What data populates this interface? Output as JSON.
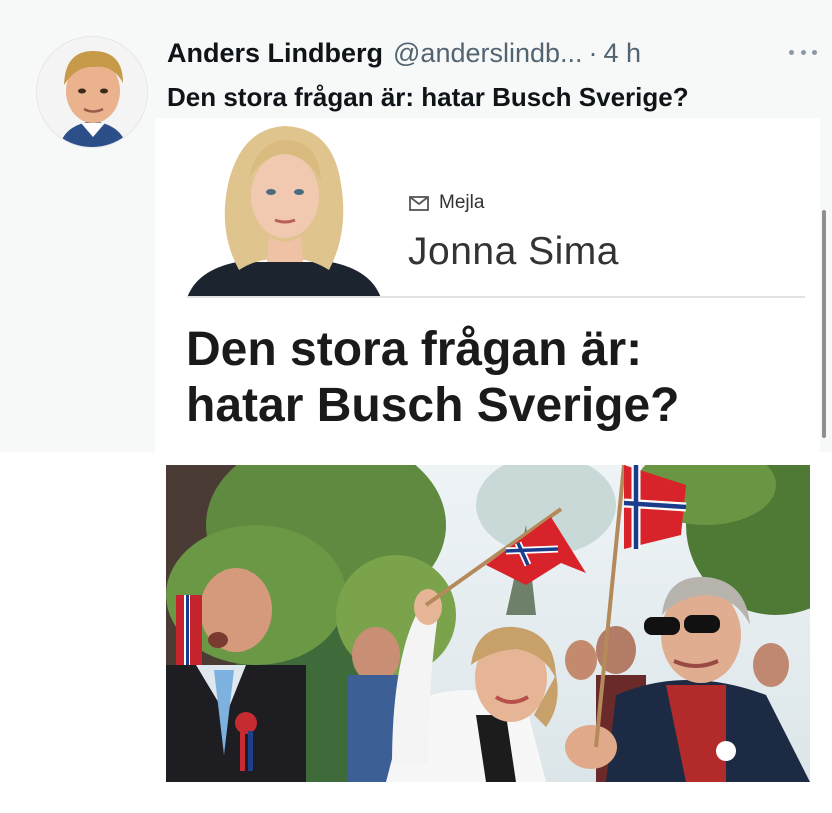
{
  "tweet": {
    "author_name": "Anders Lindberg",
    "handle": "@anderslindb...",
    "separator": "·",
    "time": "4 h",
    "text": "Den stora frågan är: hatar Busch Sverige?"
  },
  "article": {
    "mail_label": "Mejla",
    "byline": "Jonna Sima",
    "headline_line1": "Den stora frågan är:",
    "headline_line2": "hatar Busch Sverige?"
  },
  "colors": {
    "text_primary": "#0f1419",
    "text_secondary": "#536471",
    "flag_red": "#d8232a",
    "flag_blue": "#1b3b8b"
  }
}
